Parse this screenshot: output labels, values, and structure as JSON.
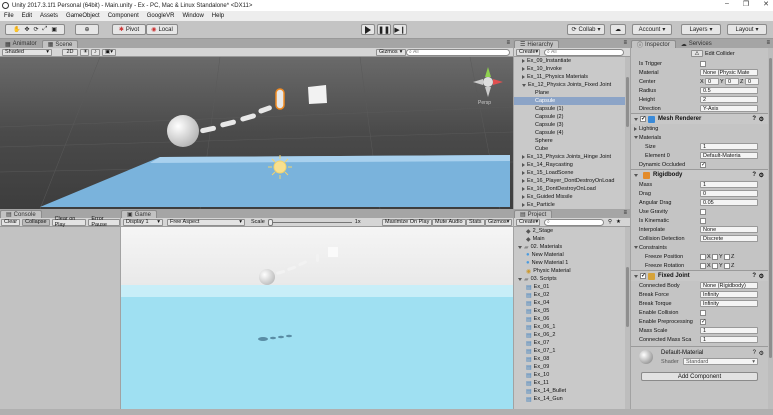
{
  "window": {
    "title": "Unity 2017.3.1f1 Personal (64bit) - Main.unity - Ex - PC, Mac & Linux Standalone* <DX11>"
  },
  "menu": [
    "File",
    "Edit",
    "Assets",
    "GameObject",
    "Component",
    "GoogleVR",
    "Window",
    "Help"
  ],
  "toolbar": {
    "pivot": "Pivot",
    "local": "Local",
    "collab": "Collab",
    "account": "Account",
    "layers": "Layers",
    "layout": "Layout"
  },
  "scene": {
    "tabs": [
      "Animator",
      "Scene"
    ],
    "shading": "Shaded",
    "mode2d": "2D",
    "gizmos": "Gizmos",
    "search_placeholder": "All",
    "persp": "Persp"
  },
  "console": {
    "tab": "Console",
    "buttons": [
      "Clear",
      "Collapse",
      "Clear on Play",
      "Error Pause"
    ]
  },
  "game": {
    "tab": "Game",
    "display": "Display 1",
    "aspect": "Free Aspect",
    "scale_label": "Scale",
    "scale_value": "1x",
    "buttons": [
      "Maximize On Play",
      "Mute Audio",
      "Stats",
      "Gizmos"
    ]
  },
  "hierarchy": {
    "tab": "Hierarchy",
    "create": "Create",
    "search_placeholder": "All",
    "items": [
      {
        "label": "Ex_09_Instantiate",
        "indent": 1,
        "arrow": "closed",
        "sel": false
      },
      {
        "label": "Ex_10_Invoke",
        "indent": 1,
        "arrow": "closed",
        "sel": false
      },
      {
        "label": "Ex_11_Physics Materials",
        "indent": 1,
        "arrow": "closed",
        "sel": false
      },
      {
        "label": "Ex_12_Physics Joints_Fixed Joint",
        "indent": 1,
        "arrow": "open",
        "sel": false
      },
      {
        "label": "Plane",
        "indent": 2,
        "arrow": "none",
        "sel": false
      },
      {
        "label": "Capsule",
        "indent": 2,
        "arrow": "none",
        "sel": true
      },
      {
        "label": "Capsule (1)",
        "indent": 2,
        "arrow": "none",
        "sel": false
      },
      {
        "label": "Capsule (2)",
        "indent": 2,
        "arrow": "none",
        "sel": false
      },
      {
        "label": "Capsule (3)",
        "indent": 2,
        "arrow": "none",
        "sel": false
      },
      {
        "label": "Capsule (4)",
        "indent": 2,
        "arrow": "none",
        "sel": false
      },
      {
        "label": "Sphere",
        "indent": 2,
        "arrow": "none",
        "sel": false
      },
      {
        "label": "Cube",
        "indent": 2,
        "arrow": "none",
        "sel": false
      },
      {
        "label": "Ex_13_Physics Joints_Hinge Joint",
        "indent": 1,
        "arrow": "closed",
        "sel": false
      },
      {
        "label": "Ex_14_Raycasting",
        "indent": 1,
        "arrow": "closed",
        "sel": false
      },
      {
        "label": "Ex_15_LoadScene",
        "indent": 1,
        "arrow": "closed",
        "sel": false
      },
      {
        "label": "Ex_16_Player_DontDestroyOnLoad",
        "indent": 1,
        "arrow": "closed",
        "sel": false
      },
      {
        "label": "Ex_16_DontDestroyOnLoad",
        "indent": 1,
        "arrow": "closed",
        "sel": false
      },
      {
        "label": "Ex_Guided Missile",
        "indent": 1,
        "arrow": "closed",
        "sel": false
      },
      {
        "label": "Ex_Particle",
        "indent": 1,
        "arrow": "closed",
        "sel": false
      }
    ]
  },
  "project": {
    "tab": "Project",
    "create": "Create",
    "items": [
      {
        "label": "2_Stage",
        "indent": 1,
        "kind": "scene"
      },
      {
        "label": "Main",
        "indent": 1,
        "kind": "scene"
      },
      {
        "label": "02. Materials",
        "indent": 0,
        "kind": "folder"
      },
      {
        "label": "New Material",
        "indent": 1,
        "kind": "material"
      },
      {
        "label": "New Material 1",
        "indent": 1,
        "kind": "material"
      },
      {
        "label": "Physic Material",
        "indent": 1,
        "kind": "physic"
      },
      {
        "label": "03. Scripts",
        "indent": 0,
        "kind": "folder"
      },
      {
        "label": "Ex_01",
        "indent": 1,
        "kind": "script"
      },
      {
        "label": "Ex_02",
        "indent": 1,
        "kind": "script"
      },
      {
        "label": "Ex_04",
        "indent": 1,
        "kind": "script"
      },
      {
        "label": "Ex_05",
        "indent": 1,
        "kind": "script"
      },
      {
        "label": "Ex_06",
        "indent": 1,
        "kind": "script"
      },
      {
        "label": "Ex_06_1",
        "indent": 1,
        "kind": "script"
      },
      {
        "label": "Ex_06_2",
        "indent": 1,
        "kind": "script"
      },
      {
        "label": "Ex_07",
        "indent": 1,
        "kind": "script"
      },
      {
        "label": "Ex_07_1",
        "indent": 1,
        "kind": "script"
      },
      {
        "label": "Ex_08",
        "indent": 1,
        "kind": "script"
      },
      {
        "label": "Ex_09",
        "indent": 1,
        "kind": "script"
      },
      {
        "label": "Ex_10",
        "indent": 1,
        "kind": "script"
      },
      {
        "label": "Ex_11",
        "indent": 1,
        "kind": "script"
      },
      {
        "label": "Ex_14_Bullet",
        "indent": 1,
        "kind": "script"
      },
      {
        "label": "Ex_14_Gun",
        "indent": 1,
        "kind": "script"
      }
    ]
  },
  "inspector": {
    "tabs": [
      "Inspector",
      "Services"
    ],
    "edit_collider": "Edit Collider",
    "capsule_collider": [
      {
        "type": "check",
        "label": "Is Trigger",
        "checked": false
      },
      {
        "type": "field",
        "label": "Material",
        "value": "None (Physic Mate"
      },
      {
        "type": "vec",
        "label": "Center",
        "x": "0",
        "y": "0",
        "z": "0"
      },
      {
        "type": "field",
        "label": "Radius",
        "value": "0.5"
      },
      {
        "type": "field",
        "label": "Height",
        "value": "2"
      },
      {
        "type": "field",
        "label": "Direction",
        "value": "Y-Axis"
      }
    ],
    "mesh_renderer": {
      "title": "Mesh Renderer",
      "rows": [
        {
          "type": "fold",
          "label": "Lighting"
        },
        {
          "type": "foldopen",
          "label": "Materials"
        },
        {
          "type": "field",
          "label": "Size",
          "value": "1",
          "indent": true
        },
        {
          "type": "field",
          "label": "Element 0",
          "value": "Default-Materia",
          "indent": true
        },
        {
          "type": "check",
          "label": "Dynamic Occluded",
          "checked": true
        }
      ]
    },
    "rigidbody": {
      "title": "Rigidbody",
      "rows": [
        {
          "type": "field",
          "label": "Mass",
          "value": "1"
        },
        {
          "type": "field",
          "label": "Drag",
          "value": "0"
        },
        {
          "type": "field",
          "label": "Angular Drag",
          "value": "0.05"
        },
        {
          "type": "check",
          "label": "Use Gravity",
          "checked": false
        },
        {
          "type": "check",
          "label": "Is Kinematic",
          "checked": false
        },
        {
          "type": "field",
          "label": "Interpolate",
          "value": "None"
        },
        {
          "type": "field",
          "label": "Collision Detection",
          "value": "Discrete"
        },
        {
          "type": "foldopen",
          "label": "Constraints"
        },
        {
          "type": "xyz",
          "label": "Freeze Position",
          "indent": true
        },
        {
          "type": "xyz",
          "label": "Freeze Rotation",
          "indent": true
        }
      ]
    },
    "fixed_joint": {
      "title": "Fixed Joint",
      "rows": [
        {
          "type": "field",
          "label": "Connected Body",
          "value": "None (Rigidbody)"
        },
        {
          "type": "field",
          "label": "Break Force",
          "value": "Infinity"
        },
        {
          "type": "field",
          "label": "Break Torque",
          "value": "Infinity"
        },
        {
          "type": "check",
          "label": "Enable Collision",
          "checked": false
        },
        {
          "type": "check",
          "label": "Enable Preprocessing",
          "checked": true
        },
        {
          "type": "field",
          "label": "Mass Scale",
          "value": "1"
        },
        {
          "type": "field",
          "label": "Connected Mass Sca",
          "value": "1"
        }
      ]
    },
    "material": {
      "name": "Default-Material",
      "shader_label": "Shader",
      "shader": "Standard"
    },
    "add_component": "Add Component"
  }
}
